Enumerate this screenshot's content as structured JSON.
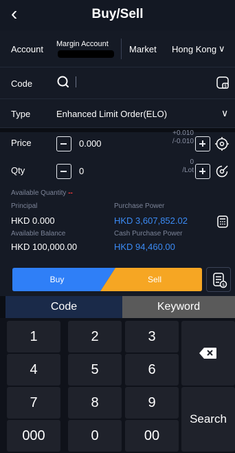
{
  "header": {
    "back_glyph": "‹",
    "title": "Buy/Sell"
  },
  "account": {
    "label": "Account",
    "name": "Margin Account",
    "market_label": "Market",
    "market_value": "Hong Kong",
    "chevron": "∨"
  },
  "code": {
    "label": "Code",
    "value": ""
  },
  "type": {
    "label": "Type",
    "value": "Enhanced Limit Order(ELO)",
    "chevron": "∨"
  },
  "price": {
    "label": "Price",
    "value": "0.000",
    "step_up": "+0.010",
    "step_down": "/-0.010"
  },
  "qty": {
    "label": "Qty",
    "value": "0",
    "lot_count": "0",
    "lot_unit": "/Lot"
  },
  "available_quantity": {
    "label": "Available Quantity",
    "value": "--"
  },
  "principal": {
    "label": "Principal",
    "value": "HKD 0.000"
  },
  "purchase_power": {
    "label": "Purchase Power",
    "value": "HKD 3,607,852.02"
  },
  "available_balance": {
    "label": "Available Balance",
    "value": "HKD 100,000.00"
  },
  "cash_purchase_power": {
    "label": "Cash Purchase Power",
    "value": "HKD 94,460.00"
  },
  "actions": {
    "buy": "Buy",
    "sell": "Sell",
    "buy_color": "#2f7ff7",
    "sell_color": "#f6a623"
  },
  "keyboard": {
    "tabs": [
      {
        "label": "Code",
        "active": true
      },
      {
        "label": "Keyword",
        "active": false
      }
    ],
    "keys": [
      "1",
      "2",
      "3",
      "4",
      "5",
      "6",
      "7",
      "8",
      "9",
      "000",
      "0",
      "00"
    ],
    "search_label": "Search",
    "backspace_icon": "backspace-icon"
  }
}
